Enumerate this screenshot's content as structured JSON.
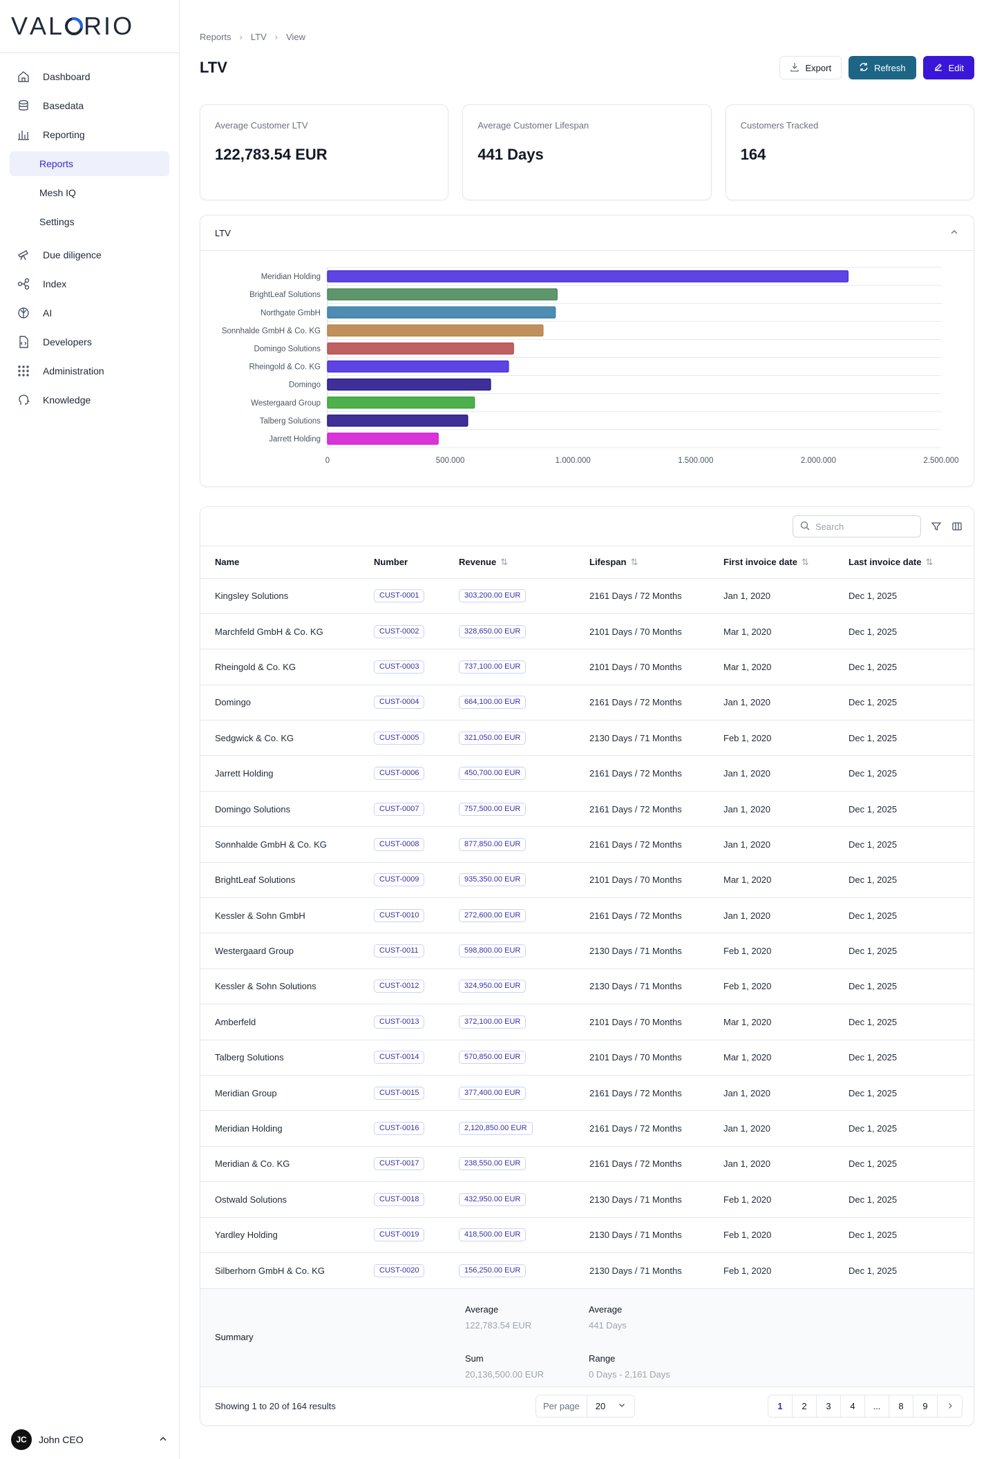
{
  "brand": {
    "logo_pre": "V",
    "logo_a": "AL",
    "logo_post": "RIO"
  },
  "sidebar": {
    "items": [
      {
        "label": "Dashboard",
        "icon": "home-icon"
      },
      {
        "label": "Basedata",
        "icon": "database-icon"
      },
      {
        "label": "Reporting",
        "icon": "bar-chart-icon"
      },
      {
        "label": "Reports",
        "sub": true,
        "active": true
      },
      {
        "label": "Mesh IQ",
        "sub": true
      },
      {
        "label": "Settings",
        "sub": true
      },
      {
        "label": "Due diligence",
        "icon": "telescope-icon"
      },
      {
        "label": "Index",
        "icon": "network-icon"
      },
      {
        "label": "AI",
        "icon": "ai-icon"
      },
      {
        "label": "Developers",
        "icon": "code-file-icon"
      },
      {
        "label": "Administration",
        "icon": "grid-dots-icon"
      },
      {
        "label": "Knowledge",
        "icon": "head-icon"
      }
    ],
    "user": {
      "initials": "JC",
      "name": "John CEO"
    }
  },
  "breadcrumb": [
    "Reports",
    "LTV",
    "View"
  ],
  "page": {
    "title": "LTV"
  },
  "actions": {
    "export": "Export",
    "refresh": "Refresh",
    "edit": "Edit"
  },
  "stats": [
    {
      "label": "Average Customer LTV",
      "value": "122,783.54 EUR"
    },
    {
      "label": "Average Customer Lifespan",
      "value": "441 Days"
    },
    {
      "label": "Customers Tracked",
      "value": "164"
    }
  ],
  "chart_panel": {
    "title": "LTV"
  },
  "chart_data": {
    "type": "bar",
    "orientation": "horizontal",
    "categories": [
      "Meridian Holding",
      "BrightLeaf Solutions",
      "Northgate GmbH",
      "Sonnhalde GmbH & Co. KG",
      "Domingo Solutions",
      "Rheingold & Co. KG",
      "Domingo",
      "Westergaard Group",
      "Talberg Solutions",
      "Jarrett Holding"
    ],
    "values": [
      2120850,
      935350,
      928000,
      877850,
      757500,
      737100,
      664100,
      598800,
      570850,
      450700
    ],
    "colors": [
      "#4b30e0",
      "#4e8a5c",
      "#3c80a8",
      "#b8844a",
      "#b85050",
      "#4b30e0",
      "#2a1a8c",
      "#3aa63a",
      "#2a1a8c",
      "#d41ed4"
    ],
    "xlim": [
      0,
      2500000
    ],
    "xticks": [
      0,
      500000,
      1000000,
      1500000,
      2000000,
      2500000
    ],
    "xtick_labels": [
      "0",
      "500.000",
      "1.000.000",
      "1.500.000",
      "2.000.000",
      "2.500.000"
    ],
    "grid": true
  },
  "table": {
    "search_placeholder": "Search",
    "headers": {
      "name": "Name",
      "number": "Number",
      "revenue": "Revenue",
      "lifespan": "Lifespan",
      "first": "First invoice date",
      "last": "Last invoice date"
    },
    "rows": [
      [
        "Kingsley Solutions",
        "CUST-0001",
        "303,200.00 EUR",
        "2161 Days / 72 Months",
        "Jan 1, 2020",
        "Dec 1, 2025"
      ],
      [
        "Marchfeld GmbH & Co. KG",
        "CUST-0002",
        "328,650.00 EUR",
        "2101 Days / 70 Months",
        "Mar 1, 2020",
        "Dec 1, 2025"
      ],
      [
        "Rheingold & Co. KG",
        "CUST-0003",
        "737,100.00 EUR",
        "2101 Days / 70 Months",
        "Mar 1, 2020",
        "Dec 1, 2025"
      ],
      [
        "Domingo",
        "CUST-0004",
        "664,100.00 EUR",
        "2161 Days / 72 Months",
        "Jan 1, 2020",
        "Dec 1, 2025"
      ],
      [
        "Sedgwick & Co. KG",
        "CUST-0005",
        "321,050.00 EUR",
        "2130 Days / 71 Months",
        "Feb 1, 2020",
        "Dec 1, 2025"
      ],
      [
        "Jarrett Holding",
        "CUST-0006",
        "450,700.00 EUR",
        "2161 Days / 72 Months",
        "Jan 1, 2020",
        "Dec 1, 2025"
      ],
      [
        "Domingo Solutions",
        "CUST-0007",
        "757,500.00 EUR",
        "2161 Days / 72 Months",
        "Jan 1, 2020",
        "Dec 1, 2025"
      ],
      [
        "Sonnhalde GmbH & Co. KG",
        "CUST-0008",
        "877,850.00 EUR",
        "2161 Days / 72 Months",
        "Jan 1, 2020",
        "Dec 1, 2025"
      ],
      [
        "BrightLeaf Solutions",
        "CUST-0009",
        "935,350.00 EUR",
        "2101 Days / 70 Months",
        "Mar 1, 2020",
        "Dec 1, 2025"
      ],
      [
        "Kessler & Sohn GmbH",
        "CUST-0010",
        "272,600.00 EUR",
        "2161 Days / 72 Months",
        "Jan 1, 2020",
        "Dec 1, 2025"
      ],
      [
        "Westergaard Group",
        "CUST-0011",
        "598,800.00 EUR",
        "2130 Days / 71 Months",
        "Feb 1, 2020",
        "Dec 1, 2025"
      ],
      [
        "Kessler & Sohn Solutions",
        "CUST-0012",
        "324,950.00 EUR",
        "2130 Days / 71 Months",
        "Feb 1, 2020",
        "Dec 1, 2025"
      ],
      [
        "Amberfeld",
        "CUST-0013",
        "372,100.00 EUR",
        "2101 Days / 70 Months",
        "Mar 1, 2020",
        "Dec 1, 2025"
      ],
      [
        "Talberg Solutions",
        "CUST-0014",
        "570,850.00 EUR",
        "2101 Days / 70 Months",
        "Mar 1, 2020",
        "Dec 1, 2025"
      ],
      [
        "Meridian Group",
        "CUST-0015",
        "377,400.00 EUR",
        "2161 Days / 72 Months",
        "Jan 1, 2020",
        "Dec 1, 2025"
      ],
      [
        "Meridian Holding",
        "CUST-0016",
        "2,120,850.00 EUR",
        "2161 Days / 72 Months",
        "Jan 1, 2020",
        "Dec 1, 2025"
      ],
      [
        "Meridian & Co. KG",
        "CUST-0017",
        "238,550.00 EUR",
        "2161 Days / 72 Months",
        "Jan 1, 2020",
        "Dec 1, 2025"
      ],
      [
        "Ostwald Solutions",
        "CUST-0018",
        "432,950.00 EUR",
        "2130 Days / 71 Months",
        "Feb 1, 2020",
        "Dec 1, 2025"
      ],
      [
        "Yardley Holding",
        "CUST-0019",
        "418,500.00 EUR",
        "2130 Days / 71 Months",
        "Feb 1, 2020",
        "Dec 1, 2025"
      ],
      [
        "Silberhorn GmbH & Co. KG",
        "CUST-0020",
        "156,250.00 EUR",
        "2130 Days / 71 Months",
        "Feb 1, 2020",
        "Dec 1, 2025"
      ]
    ],
    "summary": {
      "label": "Summary",
      "rev_avg_label": "Average",
      "rev_avg": "122,783.54 EUR",
      "rev_sum_label": "Sum",
      "rev_sum": "20,136,500.00 EUR",
      "life_avg_label": "Average",
      "life_avg": "441 Days",
      "life_range_label": "Range",
      "life_range": "0 Days - 2,161 Days"
    }
  },
  "pagination": {
    "showing": "Showing 1 to 20 of 164 results",
    "per_page_label": "Per page",
    "per_page_value": "20",
    "pages": [
      "1",
      "2",
      "3",
      "4",
      "...",
      "8",
      "9"
    ],
    "current": "1"
  }
}
